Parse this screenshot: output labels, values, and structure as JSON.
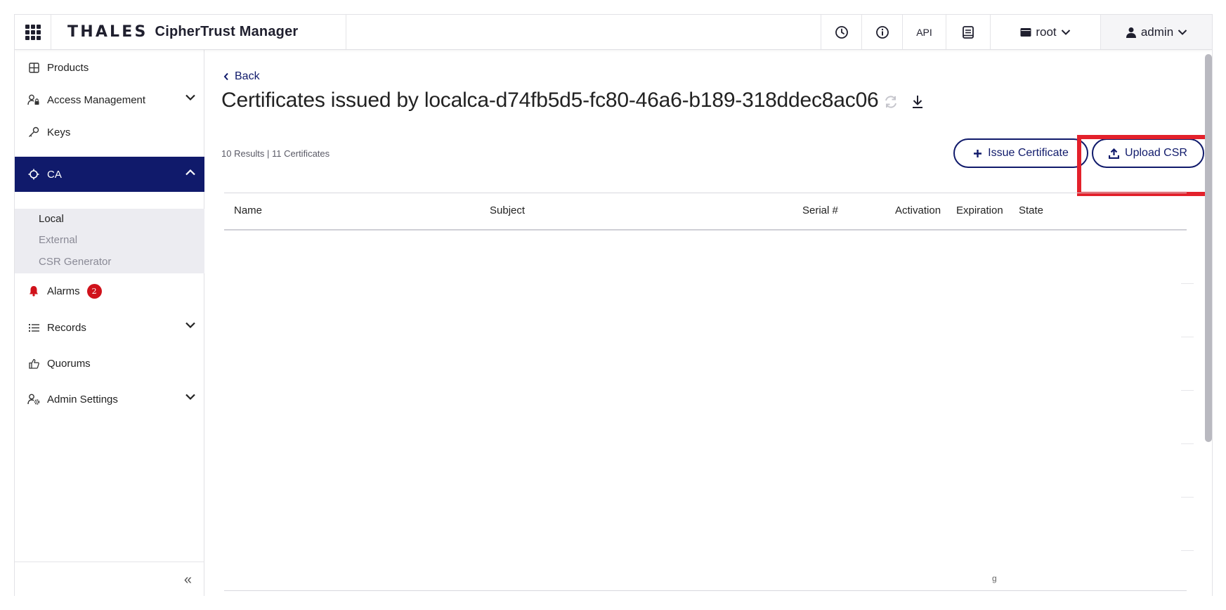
{
  "topbar": {
    "brand_logo": "THALES",
    "brand_product": "CipherTrust Manager",
    "api_label": "API",
    "domain_label": "root",
    "user_label": "admin"
  },
  "sidebar": {
    "items": [
      {
        "label": "Products",
        "icon": "grid-table-icon"
      },
      {
        "label": "Access Management",
        "icon": "user-lock-icon"
      },
      {
        "label": "Keys",
        "icon": "key-icon"
      },
      {
        "label": "CA",
        "icon": "ca-gear-icon"
      },
      {
        "label": "Alarms",
        "icon": "bell-icon",
        "badge": "2"
      },
      {
        "label": "Records",
        "icon": "list-icon"
      },
      {
        "label": "Quorums",
        "icon": "thumbs-up-icon"
      },
      {
        "label": "Admin Settings",
        "icon": "user-gear-icon"
      }
    ],
    "ca_subitems": [
      "Local",
      "External",
      "CSR Generator"
    ],
    "collapse_label": "«"
  },
  "main": {
    "back_label": "Back",
    "title": "Certificates issued by localca-d74fb5d5-fc80-46a6-b189-318ddec8ac06",
    "results_text": "10 Results | 11 Certificates",
    "issue_button": "Issue Certificate",
    "upload_button": "Upload CSR",
    "columns": [
      "Name",
      "Subject",
      "Serial #",
      "Activation",
      "Expiration",
      "State"
    ],
    "stray_glyph": "g"
  },
  "colors": {
    "brand_navy": "#101a6b",
    "highlight_red": "#e3212b",
    "badge_red": "#d0121b"
  }
}
